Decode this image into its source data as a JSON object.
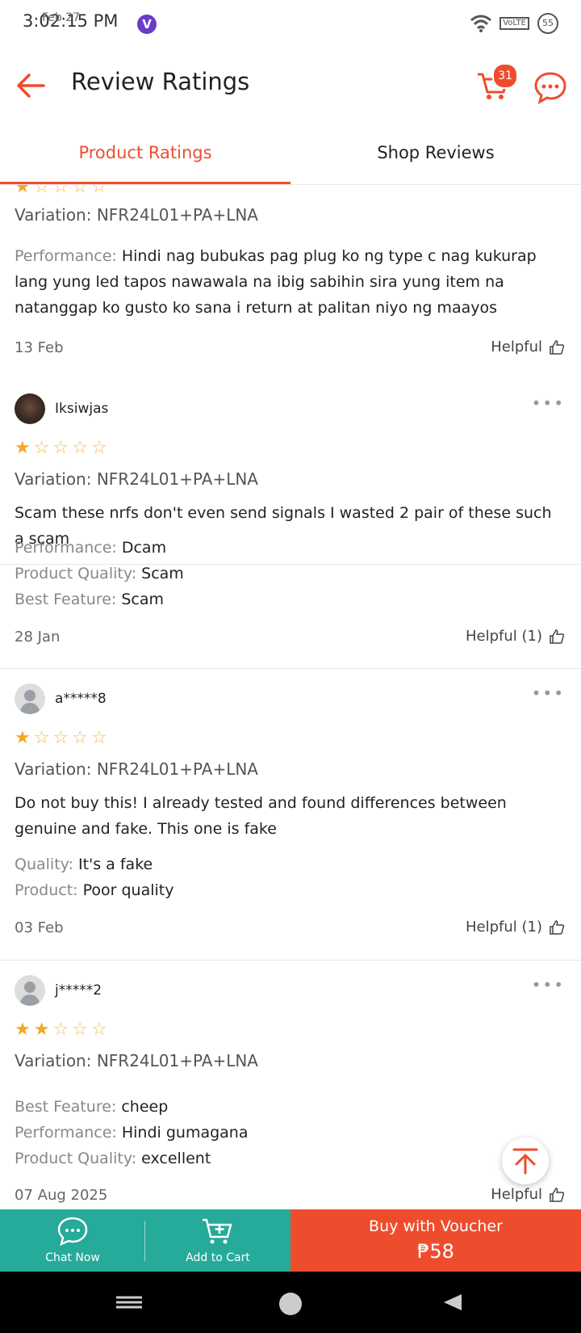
{
  "status": {
    "time": "3:02:15 PM",
    "date": "Feb 27",
    "app_badge": "V",
    "volte": "VoLTE",
    "battery": "55"
  },
  "header": {
    "title": "Review Ratings",
    "cart_count": "31"
  },
  "tabs": [
    {
      "label": "Product Ratings"
    },
    {
      "label": "Shop Reviews"
    }
  ],
  "reviews": [
    {
      "variation": "Variation: NFR24L01+PA+LNA",
      "attributes": [
        {
          "key": "Performance:",
          "value": "Hindi nag bubukas pag plug ko ng type c nag kukurap lang yung led tapos nawawala na ibig sabihin sira yung item na natanggap ko gusto ko sana i return at palitan niyo ng maayos"
        }
      ],
      "date": "13 Feb",
      "helpful": "Helpful"
    },
    {
      "user": "Iksiwjas",
      "rating": 1,
      "variation": "Variation: NFR24L01+PA+LNA",
      "text": "Scam these nrfs don't even send signals I wasted 2 pair of these such a scam",
      "attributes": [
        {
          "key": "Performance:",
          "value": "Dcam"
        },
        {
          "key": "Product Quality:",
          "value": "Scam"
        },
        {
          "key": "Best Feature:",
          "value": "Scam"
        }
      ],
      "date": "28 Jan",
      "helpful": "Helpful (1)"
    },
    {
      "user": "a*****8",
      "rating": 1,
      "variation": "Variation: NFR24L01+PA+LNA",
      "text": "Do not buy this! I already tested and found differences between genuine and fake. This one is fake",
      "attributes": [
        {
          "key": "Quality:",
          "value": "It's a fake"
        },
        {
          "key": "Product:",
          "value": "Poor quality"
        }
      ],
      "date": "03 Feb",
      "helpful": "Helpful (1)"
    },
    {
      "user": "j*****2",
      "rating": 2,
      "variation": "Variation: NFR24L01+PA+LNA",
      "attributes": [
        {
          "key": "Best Feature:",
          "value": "cheep"
        },
        {
          "key": "Performance:",
          "value": "Hindi gumagana"
        },
        {
          "key": "Product Quality:",
          "value": "excellent"
        }
      ],
      "date": "07 Aug 2025",
      "helpful": "Helpful"
    }
  ],
  "bottom": {
    "chat_label": "Chat Now",
    "cart_label": "Add to Cart",
    "buy_label": "Buy with Voucher",
    "buy_price": "₱58"
  },
  "colors": {
    "accent": "#ee4d2d",
    "teal": "#26aa99",
    "star": "#f5a623"
  }
}
